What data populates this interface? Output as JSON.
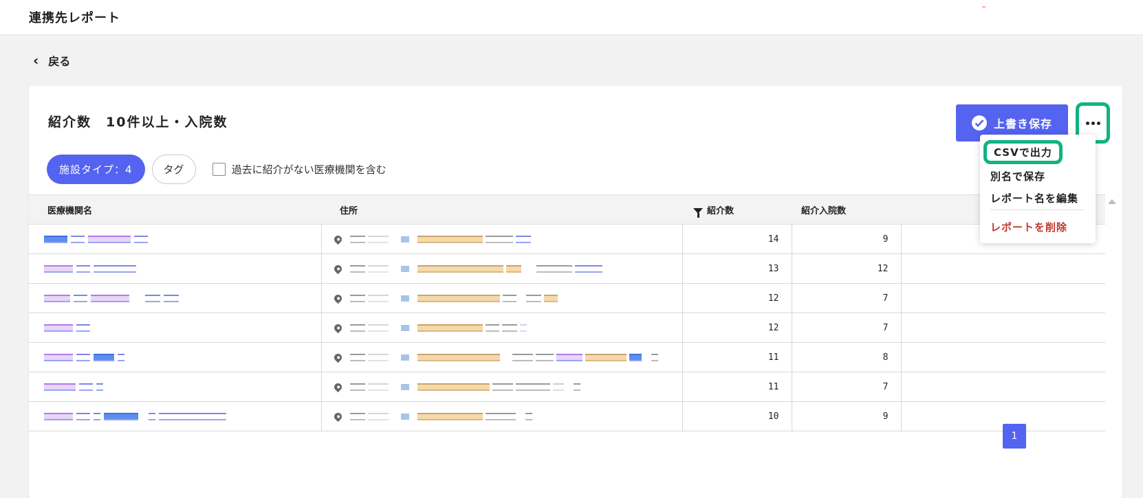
{
  "app": {
    "title": "連携先レポート"
  },
  "nav": {
    "back_label": "戻る"
  },
  "report": {
    "title": "紹介数　10件以上・入院数",
    "save_label": "上書き保存"
  },
  "filters": {
    "facility_type_chip": "施設タイプ：4",
    "tag_chip": "タグ",
    "include_no_referral_label": "過去に紹介がない医療機関を含む"
  },
  "table": {
    "columns": [
      "医療機関名",
      "住所",
      "紹介数",
      "紹介入院数"
    ],
    "rows": [
      {
        "referrals": "14",
        "admissions": "9"
      },
      {
        "referrals": "13",
        "admissions": "12"
      },
      {
        "referrals": "12",
        "admissions": "7"
      },
      {
        "referrals": "12",
        "admissions": "7"
      },
      {
        "referrals": "11",
        "admissions": "8"
      },
      {
        "referrals": "11",
        "admissions": "7"
      },
      {
        "referrals": "10",
        "admissions": "9"
      }
    ]
  },
  "pagination": {
    "current_page": "1"
  },
  "menu": {
    "items": [
      "CSVで出力",
      "別名で保存",
      "レポート名を編集",
      "レポートを削除"
    ]
  },
  "colors": {
    "accent": "#5463f0",
    "highlight": "#10b383",
    "danger": "#c0392b"
  }
}
